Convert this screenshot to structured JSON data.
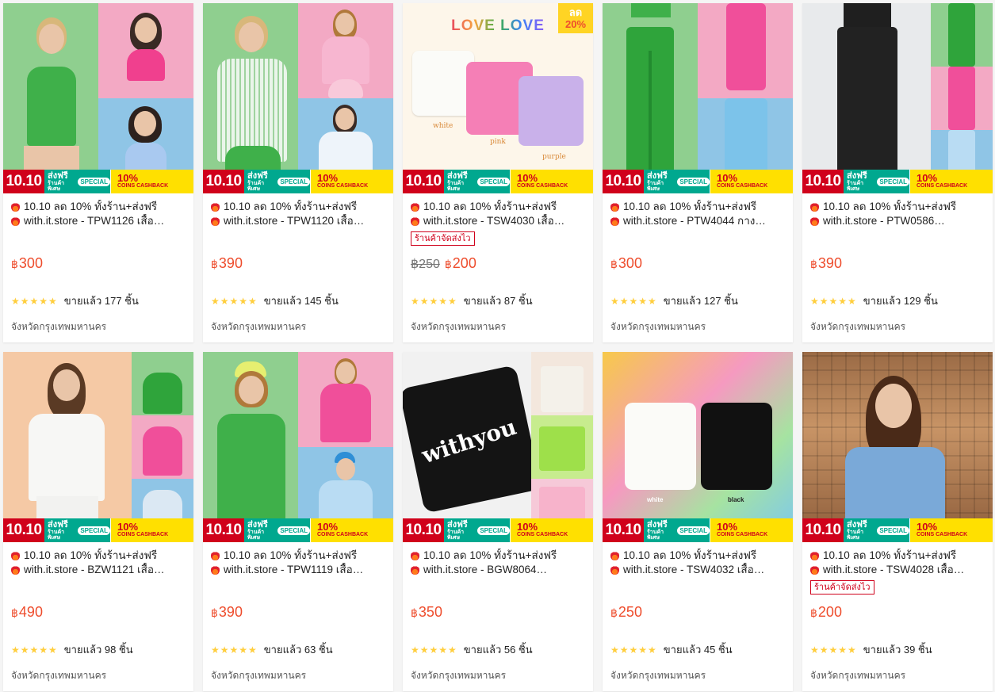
{
  "promo": {
    "tag_1010": "10.10",
    "ship_main": "ส่งฟรี",
    "ship_sub": "ร้านค้าพิเศษ",
    "special": "SPECIAL",
    "cash_pct": "10%",
    "cash_label": "COINS CASHBACK"
  },
  "shop_badge_text": "ร้านค้าจัดส่งไว",
  "currency": "฿",
  "products": [
    {
      "title1": "10.10 ลด 10% ทั้งร้าน+ส่งฟรี",
      "title2": "with.it.store - TPW1126 เสื้อ…",
      "price": "300",
      "sold": "ขายแล้ว 177 ชิ้น",
      "location": "จังหวัดกรุงเทพมหานคร",
      "stars": 5
    },
    {
      "title1": "10.10 ลด 10% ทั้งร้าน+ส่งฟรี",
      "title2": "with.it.store - TPW1120 เสื้อ…",
      "price": "390",
      "sold": "ขายแล้ว 145 ชิ้น",
      "location": "จังหวัดกรุงเทพมหานคร",
      "stars": 5
    },
    {
      "title1": "10.10 ลด 10% ทั้งร้าน+ส่งฟรี",
      "title2": "with.it.store - TSW4030 เสื้อ…",
      "orig_price": "฿250",
      "price": "200",
      "sold": "ขายแล้ว 87 ชิ้น",
      "location": "จังหวัดกรุงเทพมหานคร",
      "stars": 5,
      "discount_label": "ลด",
      "discount_value": "20%",
      "image_title": "LOVE LOVE",
      "color_labels": [
        "white",
        "pink",
        "purple"
      ]
    },
    {
      "title1": "10.10 ลด 10% ทั้งร้าน+ส่งฟรี",
      "title2": "with.it.store - PTW4044 กาง…",
      "price": "300",
      "sold": "ขายแล้ว 127 ชิ้น",
      "location": "จังหวัดกรุงเทพมหานคร",
      "stars": 5
    },
    {
      "title1": "10.10 ลด 10% ทั้งร้าน+ส่งฟรี",
      "title2": "with.it.store - PTW0586…",
      "price": "390",
      "sold": "ขายแล้ว 129 ชิ้น",
      "location": "จังหวัดกรุงเทพมหานคร",
      "stars": 5
    },
    {
      "title1": "10.10 ลด 10% ทั้งร้าน+ส่งฟรี",
      "title2": "with.it.store - BZW1121 เสื้อ…",
      "price": "490",
      "sold": "ขายแล้ว 98 ชิ้น",
      "location": "จังหวัดกรุงเทพมหานคร",
      "stars": 5
    },
    {
      "title1": "10.10 ลด 10% ทั้งร้าน+ส่งฟรี",
      "title2": "with.it.store - TPW1119 เสื้อ…",
      "price": "390",
      "sold": "ขายแล้ว 63 ชิ้น",
      "location": "จังหวัดกรุงเทพมหานคร",
      "stars": 5
    },
    {
      "title1": "10.10 ลด 10% ทั้งร้าน+ส่งฟรี",
      "title2": "with.it.store - BGW8064…",
      "price": "350",
      "sold": "ขายแล้ว 56 ชิ้น",
      "location": "จังหวัดกรุงเทพมหานคร",
      "stars": 5,
      "bag_text": "withyou"
    },
    {
      "title1": "10.10 ลด 10% ทั้งร้าน+ส่งฟรี",
      "title2": "with.it.store - TSW4032 เสื้อ…",
      "price": "250",
      "sold": "ขายแล้ว 45 ชิ้น",
      "location": "จังหวัดกรุงเทพมหานคร",
      "stars": 5,
      "color_labels": [
        "white",
        "black"
      ]
    },
    {
      "title1": "10.10 ลด 10% ทั้งร้าน+ส่งฟรี",
      "title2": "with.it.store - TSW4028 เสื้อ…",
      "price": "200",
      "sold": "ขายแล้ว 39 ชิ้น",
      "location": "จังหวัดกรุงเทพมหานคร",
      "stars": 5
    }
  ]
}
